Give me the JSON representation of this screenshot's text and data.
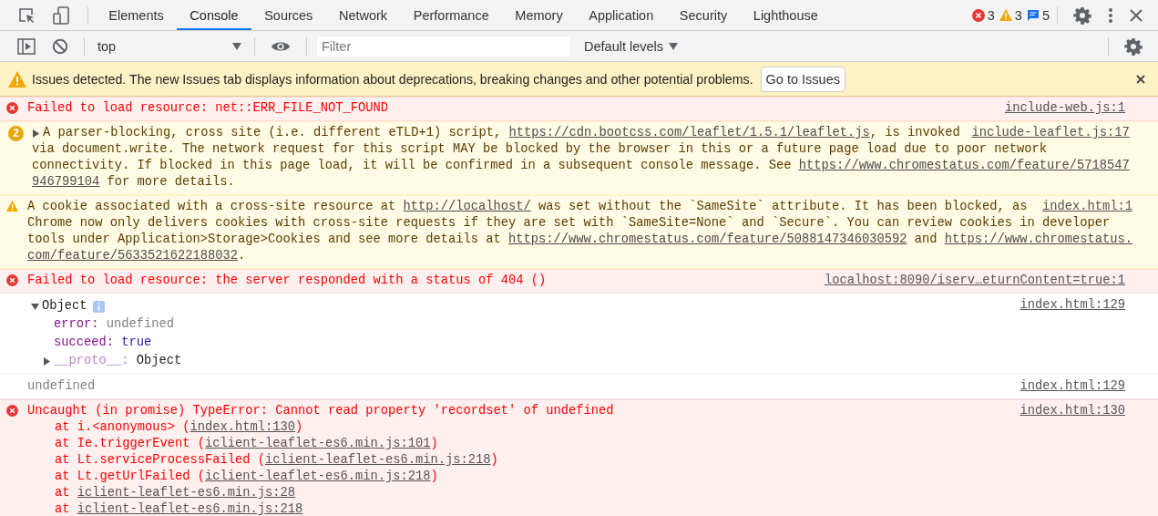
{
  "toolbar": {
    "tabs": [
      {
        "label": "Elements",
        "selected": false
      },
      {
        "label": "Console",
        "selected": true
      },
      {
        "label": "Sources",
        "selected": false
      },
      {
        "label": "Network",
        "selected": false
      },
      {
        "label": "Performance",
        "selected": false
      },
      {
        "label": "Memory",
        "selected": false
      },
      {
        "label": "Application",
        "selected": false
      },
      {
        "label": "Security",
        "selected": false
      },
      {
        "label": "Lighthouse",
        "selected": false
      }
    ],
    "counts": [
      {
        "kind": "error",
        "count": "3"
      },
      {
        "kind": "warning",
        "count": "3"
      },
      {
        "kind": "message",
        "count": "5"
      }
    ]
  },
  "console_bar": {
    "context": "top",
    "filter_placeholder": "Filter",
    "levels": "Default levels"
  },
  "issues_banner": {
    "text": "Issues detected. The new Issues tab displays information about deprecations, breaking changes and other potential problems.",
    "button": "Go to Issues"
  },
  "messages": [
    {
      "kind": "error",
      "source": "include-web.js:1",
      "lines": [
        [
          {
            "text": "Failed to load resource: net::ERR_FILE_NOT_FOUND",
            "link": false
          }
        ]
      ]
    },
    {
      "kind": "warning",
      "repeat": "2",
      "expanded": false,
      "source": "include-leaflet.js:17",
      "lines": [
        [
          {
            "text": "A parser-blocking, cross site (i.e. different eTLD+1) script, ",
            "link": false
          },
          {
            "text": "https://cdn.bootcss.com/leaflet/1.5.1/leaflet.js",
            "link": true
          },
          {
            "text": ", is invoked",
            "link": false
          }
        ],
        [
          {
            "text": "via document.write. The network request for this script MAY be blocked by the browser in this or a future page load due to poor network",
            "link": false
          }
        ],
        [
          {
            "text": "connectivity. If blocked in this page load, it will be confirmed in a subsequent console message. See ",
            "link": false
          },
          {
            "text": "https://www.chromestatus.com/feature/5718547",
            "link": true
          }
        ],
        [
          {
            "text": "946799104",
            "link": true
          },
          {
            "text": " for more details.",
            "link": false
          }
        ]
      ]
    },
    {
      "kind": "warning",
      "source": "index.html:1",
      "lines": [
        [
          {
            "text": "A cookie associated with a cross-site resource at ",
            "link": false
          },
          {
            "text": "http://localhost/",
            "link": true
          },
          {
            "text": " was set without the `SameSite` attribute. It has been blocked, as",
            "link": false
          }
        ],
        [
          {
            "text": "Chrome now only delivers cookies with cross-site requests if they are set with `SameSite=None` and `Secure`. You can review cookies in developer",
            "link": false
          }
        ],
        [
          {
            "text": "tools under Application>Storage>Cookies and see more details at ",
            "link": false
          },
          {
            "text": "https://www.chromestatus.com/feature/5088147346030592",
            "link": true
          },
          {
            "text": " and ",
            "link": false
          },
          {
            "text": "https://www.chromestatus.",
            "link": true
          }
        ],
        [
          {
            "text": "com/feature/5633521622188032",
            "link": true
          },
          {
            "text": ".",
            "link": false
          }
        ]
      ]
    },
    {
      "kind": "error",
      "source": "localhost:8090/iserv…eturnContent=true:1",
      "lines": [
        [
          {
            "text": "Failed to load resource: the server responded with a status of 404 ()",
            "link": false
          }
        ]
      ]
    },
    {
      "kind": "object",
      "source": "index.html:129",
      "label": "Object",
      "expanded": true,
      "properties": [
        {
          "key": "error:",
          "value": "undefined",
          "kind": "undefined"
        },
        {
          "key": "succeed:",
          "value": "true",
          "kind": "boolean"
        },
        {
          "key": "__proto__:",
          "value": "Object",
          "kind": "proto",
          "expanded": false
        }
      ]
    },
    {
      "kind": "undefined",
      "source": "index.html:129",
      "lines": [
        [
          {
            "text": "undefined",
            "link": false
          }
        ]
      ]
    },
    {
      "kind": "error",
      "source": "index.html:130",
      "lines": [
        [
          {
            "text": "Uncaught (in promise) TypeError: Cannot read property 'recordset' of undefined",
            "link": false
          }
        ]
      ],
      "stack": [
        [
          {
            "text": "at i.<anonymous> (",
            "link": false
          },
          {
            "text": "index.html:130",
            "link": true
          },
          {
            "text": ")",
            "link": false
          }
        ],
        [
          {
            "text": "at Ie.triggerEvent (",
            "link": false
          },
          {
            "text": "iclient-leaflet-es6.min.js:101",
            "link": true
          },
          {
            "text": ")",
            "link": false
          }
        ],
        [
          {
            "text": "at Lt.serviceProcessFailed (",
            "link": false
          },
          {
            "text": "iclient-leaflet-es6.min.js:218",
            "link": true
          },
          {
            "text": ")",
            "link": false
          }
        ],
        [
          {
            "text": "at Lt.getUrlFailed (",
            "link": false
          },
          {
            "text": "iclient-leaflet-es6.min.js:218",
            "link": true
          },
          {
            "text": ")",
            "link": false
          }
        ],
        [
          {
            "text": "at ",
            "link": false
          },
          {
            "text": "iclient-leaflet-es6.min.js:28",
            "link": true
          }
        ],
        [
          {
            "text": "at ",
            "link": false
          },
          {
            "text": "iclient-leaflet-es6.min.js:218",
            "link": true
          }
        ]
      ]
    }
  ]
}
